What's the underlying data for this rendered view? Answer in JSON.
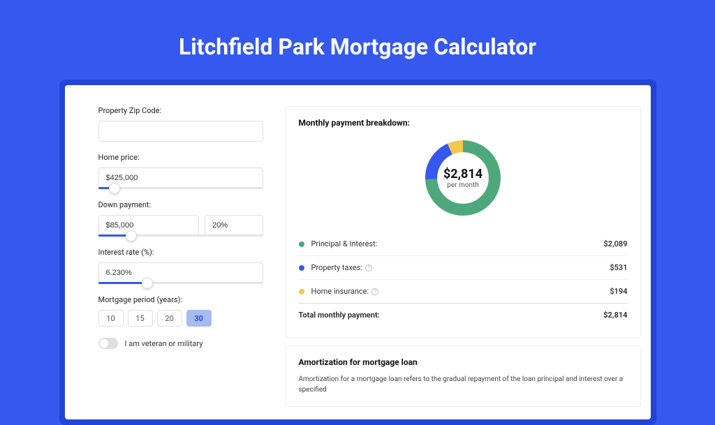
{
  "title": "Litchfield Park Mortgage Calculator",
  "colors": {
    "pi": "#4fa87b",
    "tax": "#3558ef",
    "ins": "#f3c94b"
  },
  "form": {
    "zip": {
      "label": "Property Zip Code:",
      "value": ""
    },
    "homePrice": {
      "label": "Home price:",
      "value": "$425,000",
      "sliderPct": 10
    },
    "downPayment": {
      "label": "Down payment:",
      "amount": "$85,000",
      "pct": "20%",
      "sliderPct": 20
    },
    "interestRate": {
      "label": "Interest rate (%):",
      "value": "6.230%",
      "sliderPct": 30
    },
    "period": {
      "label": "Mortgage period (years):",
      "options": [
        "10",
        "15",
        "20",
        "30"
      ],
      "selected": "30"
    },
    "veteran": {
      "label": "I am veteran or military"
    }
  },
  "breakdown": {
    "title": "Monthly payment breakdown:",
    "centerAmount": "$2,814",
    "centerSub": "per month",
    "items": [
      {
        "label": "Principal & Interest:",
        "value": "$2,089",
        "colorKey": "pi",
        "info": false
      },
      {
        "label": "Property taxes:",
        "value": "$531",
        "colorKey": "tax",
        "info": true
      },
      {
        "label": "Home insurance:",
        "value": "$194",
        "colorKey": "ins",
        "info": true
      }
    ],
    "total": {
      "label": "Total monthly payment:",
      "value": "$2,814"
    }
  },
  "amort": {
    "title": "Amortization for mortgage loan",
    "text": "Amortization for a mortgage loan refers to the gradual repayment of the loan principal and interest over a specified"
  },
  "chart_data": {
    "type": "pie",
    "title": "Monthly payment breakdown",
    "series": [
      {
        "name": "Principal & Interest",
        "value": 2089
      },
      {
        "name": "Property taxes",
        "value": 531
      },
      {
        "name": "Home insurance",
        "value": 194
      }
    ],
    "total": 2814,
    "unit": "USD/month"
  }
}
